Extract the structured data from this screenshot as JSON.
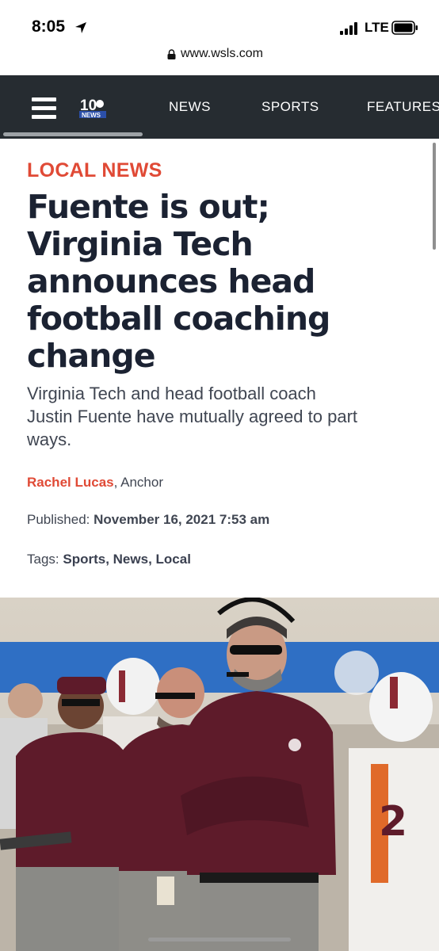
{
  "status_bar": {
    "time": "8:05",
    "network": "LTE",
    "url": "www.wsls.com"
  },
  "site": {
    "logo_number": "10",
    "logo_text": "NEWS",
    "nav": [
      "NEWS",
      "SPORTS",
      "FEATURES"
    ]
  },
  "article": {
    "section": "LOCAL NEWS",
    "headline_lines": [
      "Fuente is out;",
      "Virginia Tech",
      "announces head",
      "football coaching",
      "change"
    ],
    "subhead_lines": [
      "Virginia Tech and head football coach",
      "Justin Fuente have mutually agreed to part",
      "ways."
    ],
    "author": "Rachel Lucas",
    "author_role": ", Anchor",
    "published_label": "Published: ",
    "published_date": "November 16, 2021 7:53 am",
    "tags_label": "Tags: ",
    "tags": [
      "Sports",
      "News",
      "Local"
    ]
  },
  "photo": {
    "description_icon": "football-coach-photo"
  },
  "colors": {
    "accent": "#e04a36",
    "nav_bg": "#262c31",
    "headline": "#1b2232",
    "maroon": "#5e1b2a"
  }
}
